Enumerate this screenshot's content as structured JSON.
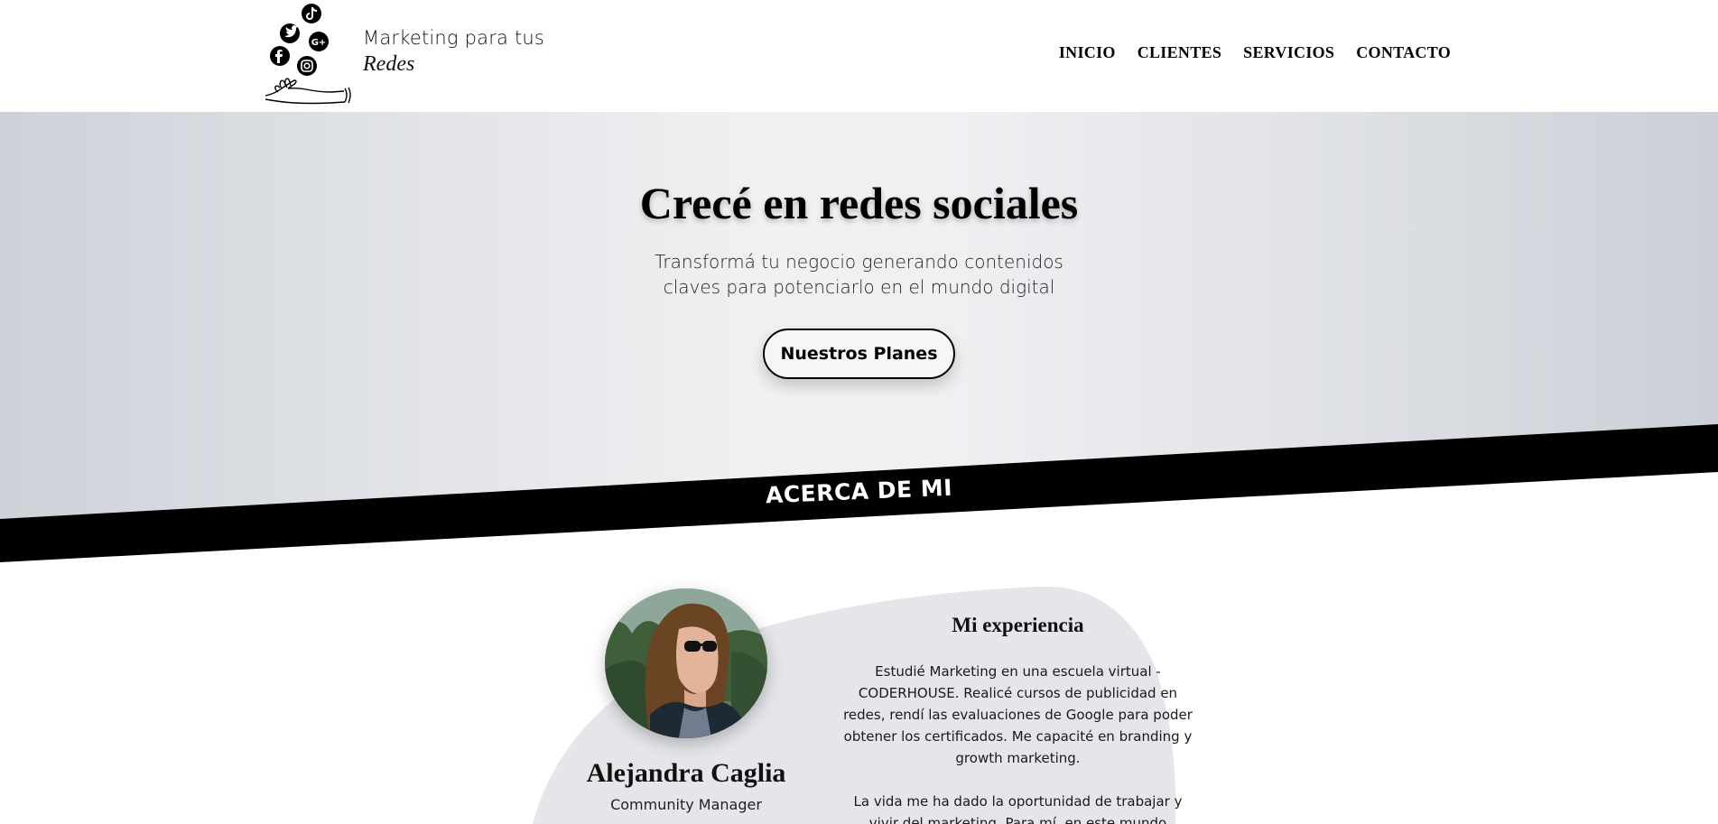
{
  "header": {
    "logo_line1": "Marketing para tus",
    "logo_line2": "Redes",
    "nav": [
      {
        "label": "INICIO"
      },
      {
        "label": "CLIENTES"
      },
      {
        "label": "SERVICIOS"
      },
      {
        "label": "CONTACTO"
      }
    ]
  },
  "hero": {
    "title": "Crecé en redes sociales",
    "subtitle_line1": "Transformá tu negocio generando contenidos",
    "subtitle_line2": "claves para potenciarlo en el mundo digital",
    "button_label": "Nuestros Planes"
  },
  "about": {
    "section_label": "ACERCA DE MI",
    "name": "Alejandra Caglia",
    "role": "Community Manager",
    "experience_title": "Mi experiencia",
    "paragraph1": "Estudié Marketing en una escuela virtual - CODERHOUSE. Realicé cursos de publicidad en redes, rendí las evaluaciones de Google para poder obtener los certificados. Me capacité en branding y growth marketing.",
    "paragraph2": "La vida me ha dado la oportunidad de trabajar y vivir del marketing. Para mí, en este mundo"
  },
  "colors": {
    "banner": "#000000",
    "hero_bg": "#e6e8eb",
    "blob": "#e4e6ea"
  },
  "icons": [
    "tiktok-icon",
    "twitter-icon",
    "google-plus-icon",
    "facebook-icon",
    "instagram-icon",
    "hand-icon"
  ]
}
